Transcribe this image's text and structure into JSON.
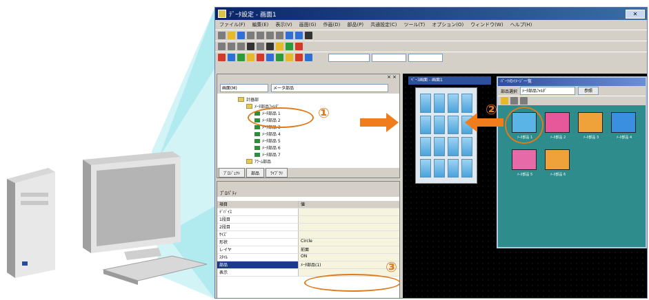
{
  "app": {
    "title": "ﾃﾞｰﾀ設定 - 画面1",
    "close_glyph": "✕",
    "menu": [
      "ファイル(F)",
      "編集(E)",
      "表示(V)",
      "画面(G)",
      "作画(D)",
      "部品(P)",
      "共通設定(C)",
      "ツール(T)",
      "オプション(O)",
      "ウィンドウ(W)",
      "ヘルプ(H)"
    ]
  },
  "explorer": {
    "panel_tag": "× ×",
    "combo_left": "画面(M)",
    "combo_right": "メータ部品",
    "tree": [
      "計器部",
      "ﾒｰﾀ部品ﾌｫﾙﾀﾞ",
      "ﾒｰﾀ部品 1",
      "ﾒｰﾀ部品 2",
      "ﾒｰﾀ部品 3",
      "ﾒｰﾀ部品 4",
      "ﾒｰﾀ部品 5",
      "ﾒｰﾀ部品 6",
      "ﾒｰﾀ部品 7",
      "ｱﾗｰﾑ部品"
    ],
    "tabs": [
      "ﾌﾟﾛｼﾞｪｸﾄ",
      "部品",
      "ﾗｲﾌﾞﾗﾘ"
    ]
  },
  "properties": {
    "panel_tag": "× ×",
    "title": "ﾌﾟﾛﾊﾟﾃｨ",
    "header_name": "項目",
    "header_value": "値",
    "rows": [
      {
        "name": "ﾃﾞﾊﾞｲｽ",
        "value": ""
      },
      {
        "name": "1段目",
        "value": ""
      },
      {
        "name": "2段目",
        "value": ""
      },
      {
        "name": "ｻｲｽﾞ",
        "value": ""
      },
      {
        "name": "形状",
        "value": "Circle"
      },
      {
        "name": "レイヤ",
        "value": "前面"
      },
      {
        "name": "ｽﾀｲﾙ",
        "value": "ON"
      },
      {
        "name": "部品",
        "value": "ﾒｰﾀ部品(1)"
      },
      {
        "name": "表示",
        "value": ""
      }
    ]
  },
  "canvas": {
    "subwindow_title": "ﾍﾞｰｽ画面 - 画面1",
    "meter_count": 16
  },
  "palette": {
    "title": "ﾊﾟｰﾂのｲﾒｰｼﾞ一覧",
    "filter_label": "部品選択",
    "filter_value": "ﾒｰﾀ部品ﾌｫﾙﾀﾞ",
    "button_label": "参照",
    "thumbnails": [
      {
        "label": "ﾒｰﾀ部品 1",
        "color": "#5ab4e6"
      },
      {
        "label": "ﾒｰﾀ部品 2",
        "color": "#e6589a"
      },
      {
        "label": "ﾒｰﾀ部品 3",
        "color": "#f0a23a"
      },
      {
        "label": "ﾒｰﾀ部品 4",
        "color": "#3a8fe0"
      },
      {
        "label": "ﾒｰﾀ部品 5",
        "color": "#e66aa8"
      },
      {
        "label": "ﾒｰﾀ部品 6",
        "color": "#f0a23a"
      }
    ]
  },
  "callouts": [
    "①",
    "②",
    "③"
  ],
  "colors": {
    "accent": "#ef7d1c",
    "beam": "#8fe0e8",
    "palette_bg": "#2e8c8c"
  }
}
